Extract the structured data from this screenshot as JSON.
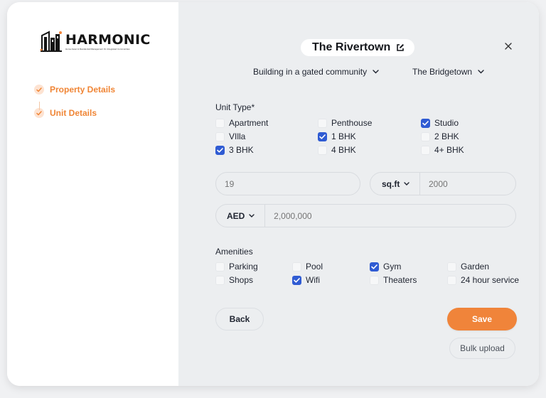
{
  "brand": {
    "name": "HARMONIC",
    "tagline": "Home Asset & Residential Management On Integrated Communities"
  },
  "steps": [
    {
      "label": "Property Details",
      "done": true
    },
    {
      "label": "Unit Details",
      "done": true
    }
  ],
  "header": {
    "title": "The Rivertown",
    "property_type": "Building in a gated community",
    "building": "The Bridgetown"
  },
  "unit_type": {
    "label": "Unit Type*",
    "options": [
      {
        "label": "Apartment",
        "checked": false
      },
      {
        "label": "Penthouse",
        "checked": false
      },
      {
        "label": "Studio",
        "checked": true
      },
      {
        "label": "VIlla",
        "checked": false
      },
      {
        "label": "1 BHK",
        "checked": true
      },
      {
        "label": "2 BHK",
        "checked": false
      },
      {
        "label": "3 BHK",
        "checked": true
      },
      {
        "label": "4 BHK",
        "checked": false
      },
      {
        "label": "4+ BHK",
        "checked": false
      }
    ]
  },
  "fields": {
    "unit_placeholder": "19",
    "area_unit": "sq.ft",
    "area_placeholder": "2000",
    "currency": "AED",
    "price_placeholder": "2,000,000"
  },
  "amenities": {
    "label": "Amenities",
    "options": [
      {
        "label": "Parking",
        "checked": false
      },
      {
        "label": "Pool",
        "checked": false
      },
      {
        "label": "Gym",
        "checked": true
      },
      {
        "label": "Garden",
        "checked": false
      },
      {
        "label": "Shops",
        "checked": false
      },
      {
        "label": "Wifi",
        "checked": true
      },
      {
        "label": "Theaters",
        "checked": false
      },
      {
        "label": "24 hour service",
        "checked": false
      }
    ]
  },
  "actions": {
    "back": "Back",
    "save": "Save",
    "bulk": "Bulk upload"
  },
  "colors": {
    "accent": "#f0843a",
    "checkbox": "#2f5bd3",
    "step": "#f08535"
  },
  "icons": {
    "close": "close-icon",
    "edit": "edit-icon",
    "check": "check-icon",
    "chevron": "chevron-down-icon"
  }
}
